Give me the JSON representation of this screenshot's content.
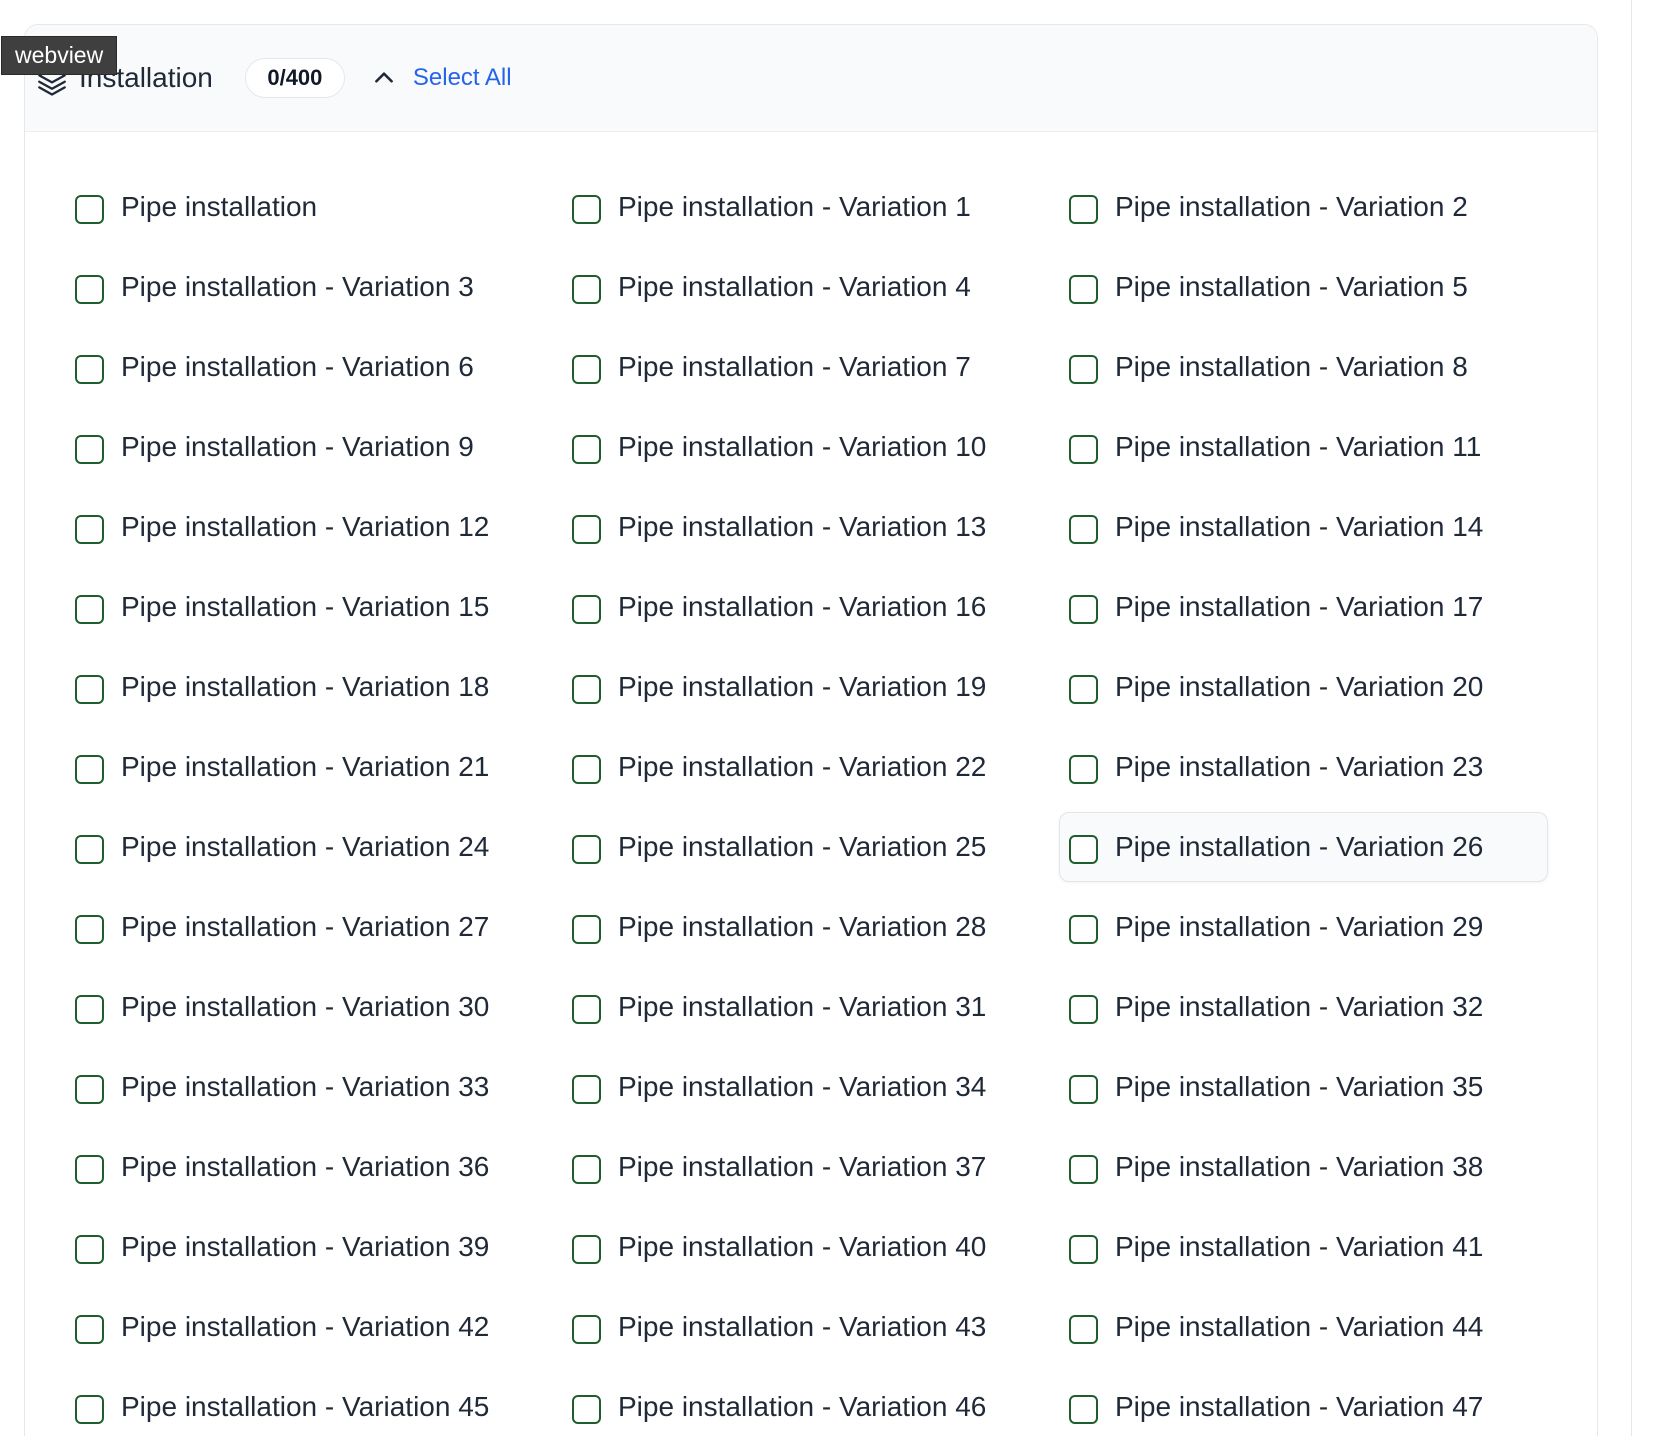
{
  "webview_tag": "webview",
  "section": {
    "title": "Installation",
    "count": "0/400",
    "select_all_label": "Select All",
    "collapse_icon": "chevron-up-icon",
    "section_icon": "layers-icon"
  },
  "colors": {
    "checkbox_border": "#1f5e2c",
    "link": "#2563eb",
    "header_bg": "#f9fafb"
  },
  "hovered_item_index": 26,
  "items": [
    {
      "label": "Pipe installation",
      "checked": false
    },
    {
      "label": "Pipe installation - Variation 1",
      "checked": false
    },
    {
      "label": "Pipe installation - Variation 2",
      "checked": false
    },
    {
      "label": "Pipe installation - Variation 3",
      "checked": false
    },
    {
      "label": "Pipe installation - Variation 4",
      "checked": false
    },
    {
      "label": "Pipe installation - Variation 5",
      "checked": false
    },
    {
      "label": "Pipe installation - Variation 6",
      "checked": false
    },
    {
      "label": "Pipe installation - Variation 7",
      "checked": false
    },
    {
      "label": "Pipe installation - Variation 8",
      "checked": false
    },
    {
      "label": "Pipe installation - Variation 9",
      "checked": false
    },
    {
      "label": "Pipe installation - Variation 10",
      "checked": false
    },
    {
      "label": "Pipe installation - Variation 11",
      "checked": false
    },
    {
      "label": "Pipe installation - Variation 12",
      "checked": false
    },
    {
      "label": "Pipe installation - Variation 13",
      "checked": false
    },
    {
      "label": "Pipe installation - Variation 14",
      "checked": false
    },
    {
      "label": "Pipe installation - Variation 15",
      "checked": false
    },
    {
      "label": "Pipe installation - Variation 16",
      "checked": false
    },
    {
      "label": "Pipe installation - Variation 17",
      "checked": false
    },
    {
      "label": "Pipe installation - Variation 18",
      "checked": false
    },
    {
      "label": "Pipe installation - Variation 19",
      "checked": false
    },
    {
      "label": "Pipe installation - Variation 20",
      "checked": false
    },
    {
      "label": "Pipe installation - Variation 21",
      "checked": false
    },
    {
      "label": "Pipe installation - Variation 22",
      "checked": false
    },
    {
      "label": "Pipe installation - Variation 23",
      "checked": false
    },
    {
      "label": "Pipe installation - Variation 24",
      "checked": false
    },
    {
      "label": "Pipe installation - Variation 25",
      "checked": false
    },
    {
      "label": "Pipe installation - Variation 26",
      "checked": false
    },
    {
      "label": "Pipe installation - Variation 27",
      "checked": false
    },
    {
      "label": "Pipe installation - Variation 28",
      "checked": false
    },
    {
      "label": "Pipe installation - Variation 29",
      "checked": false
    },
    {
      "label": "Pipe installation - Variation 30",
      "checked": false
    },
    {
      "label": "Pipe installation - Variation 31",
      "checked": false
    },
    {
      "label": "Pipe installation - Variation 32",
      "checked": false
    },
    {
      "label": "Pipe installation - Variation 33",
      "checked": false
    },
    {
      "label": "Pipe installation - Variation 34",
      "checked": false
    },
    {
      "label": "Pipe installation - Variation 35",
      "checked": false
    },
    {
      "label": "Pipe installation - Variation 36",
      "checked": false
    },
    {
      "label": "Pipe installation - Variation 37",
      "checked": false
    },
    {
      "label": "Pipe installation - Variation 38",
      "checked": false
    },
    {
      "label": "Pipe installation - Variation 39",
      "checked": false
    },
    {
      "label": "Pipe installation - Variation 40",
      "checked": false
    },
    {
      "label": "Pipe installation - Variation 41",
      "checked": false
    },
    {
      "label": "Pipe installation - Variation 42",
      "checked": false
    },
    {
      "label": "Pipe installation - Variation 43",
      "checked": false
    },
    {
      "label": "Pipe installation - Variation 44",
      "checked": false
    },
    {
      "label": "Pipe installation - Variation 45",
      "checked": false
    },
    {
      "label": "Pipe installation - Variation 46",
      "checked": false
    },
    {
      "label": "Pipe installation - Variation 47",
      "checked": false
    }
  ]
}
